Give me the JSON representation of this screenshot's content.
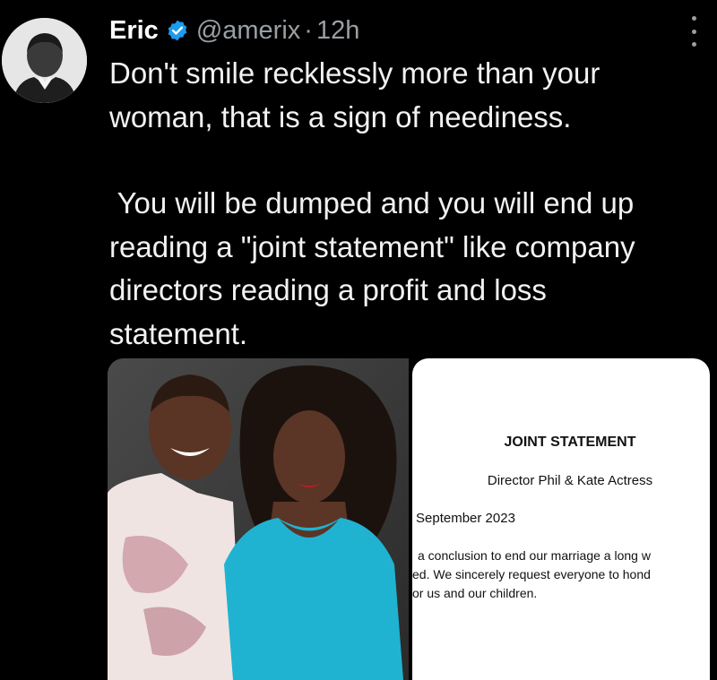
{
  "tweet": {
    "author_name": "Eric",
    "handle": "@amerix",
    "separator": "·",
    "time": "12h",
    "paragraph1_lines": [
      "Don't smile recklessly more than your",
      "woman, that is a sign of neediness."
    ],
    "paragraph2_lines": [
      " You will be dumped and you will end up",
      "reading a \"joint statement\" like company",
      "directors reading a profit and loss",
      "statement."
    ]
  },
  "icons": {
    "verified": "verified-badge-icon",
    "more": "more-options-icon"
  },
  "colors": {
    "background": "#000000",
    "text": "#f2f2f2",
    "secondary": "#9a9fa4",
    "verified_blue": "#1d9bf0",
    "dress_cyan": "#1fb3d1"
  },
  "statement_image": {
    "title": "JOINT STATEMENT",
    "parties": "Director Phil & Kate Actress",
    "date": "September 2023",
    "body_lines": [
      "a conclusion to end our marriage a long w",
      "ed. We sincerely request everyone to hond",
      "or us and our children."
    ]
  }
}
